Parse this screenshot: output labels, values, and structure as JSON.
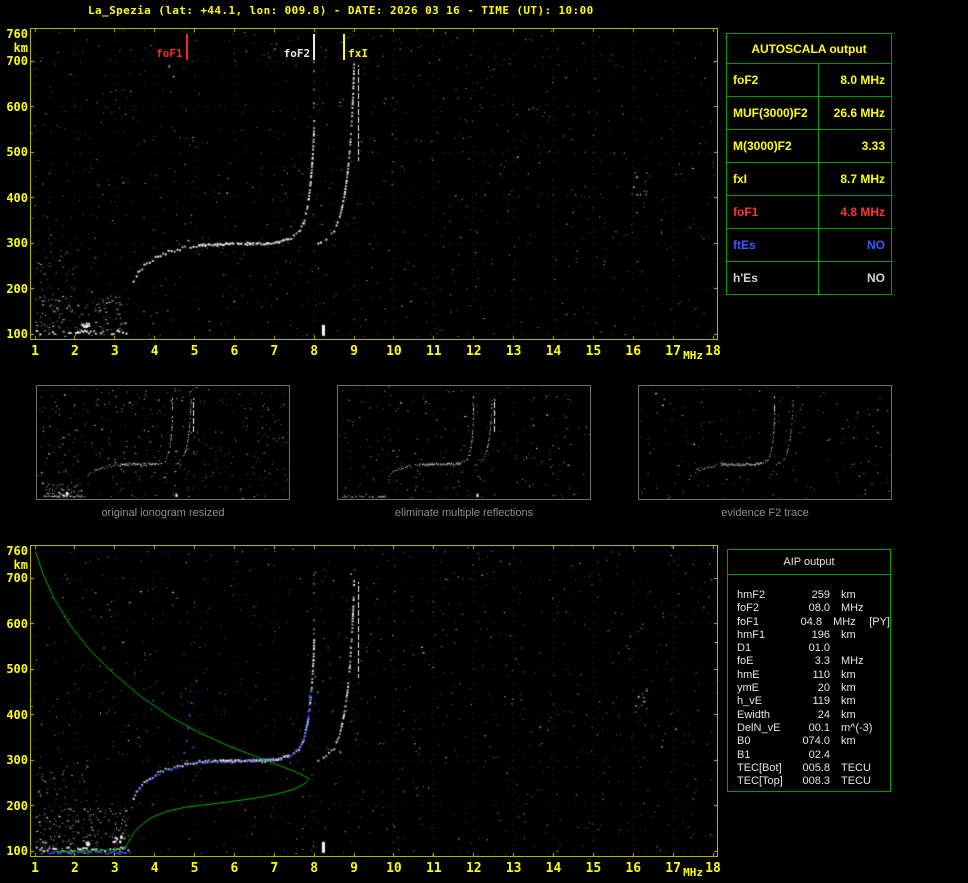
{
  "window": {
    "title": "La_Spezia (lat: +44.1, lon: 009.8) - DATE: 2026 03 16 - TIME (UT): 10:00"
  },
  "axes": {
    "x_ticks": [
      "1",
      "2",
      "3",
      "4",
      "5",
      "6",
      "7",
      "8",
      "9",
      "10",
      "11",
      "12",
      "13",
      "14",
      "15",
      "16",
      "17",
      "18"
    ],
    "x_unit": "MHz",
    "y_ticks": [
      "760",
      "700",
      "600",
      "500",
      "400",
      "300",
      "200",
      "100"
    ],
    "y_unit": "km"
  },
  "top_panel": {
    "markers": [
      {
        "label": "foF1",
        "f": 4.8,
        "color": "#ff2222",
        "side": "left"
      },
      {
        "label": "foF2",
        "f": 8.0,
        "color": "#e8e8e8",
        "side": "left"
      },
      {
        "label": "fxI",
        "f": 8.75,
        "color": "#ffff00",
        "side": "right"
      }
    ]
  },
  "thumbnails": [
    {
      "caption": "original ionogram resized"
    },
    {
      "caption": "eliminate multiple reflections"
    },
    {
      "caption": "evidence F2 trace"
    }
  ],
  "autoscala": {
    "title": "AUTOSCALA output",
    "rows": [
      {
        "param": "foF2",
        "value": "8.0 MHz",
        "color": "#ffff00"
      },
      {
        "param": "MUF(3000)F2",
        "value": "26.6 MHz",
        "color": "#ffff00"
      },
      {
        "param": "M(3000)F2",
        "value": "3.33",
        "color": "#ffff00"
      },
      {
        "param": "fxI",
        "value": "8.7 MHz",
        "color": "#ffff00"
      },
      {
        "param": "foF1",
        "value": "4.8 MHz",
        "color": "#ff3333"
      },
      {
        "param": "ftEs",
        "value": "NO",
        "color": "#3a5bff"
      },
      {
        "param": "h'Es",
        "value": "NO",
        "color": "#d4d4d4"
      }
    ]
  },
  "aip": {
    "title": "AIP output",
    "rows": [
      {
        "param": "hmF2",
        "value": "259",
        "unit": "km",
        "extra": ""
      },
      {
        "param": "foF2",
        "value": "08.0",
        "unit": "MHz",
        "extra": ""
      },
      {
        "param": "foF1",
        "value": "04.8",
        "unit": "MHz",
        "extra": "[PY]"
      },
      {
        "param": "hmF1",
        "value": "196",
        "unit": "km",
        "extra": ""
      },
      {
        "param": "D1",
        "value": "01.0",
        "unit": "",
        "extra": ""
      },
      {
        "param": "foE",
        "value": "3.3",
        "unit": "MHz",
        "extra": ""
      },
      {
        "param": "hmE",
        "value": "110",
        "unit": "km",
        "extra": ""
      },
      {
        "param": "ymE",
        "value": "20",
        "unit": "km",
        "extra": ""
      },
      {
        "param": "h_vE",
        "value": "119",
        "unit": "km",
        "extra": ""
      },
      {
        "param": "Ewidth",
        "value": "24",
        "unit": "km",
        "extra": ""
      },
      {
        "param": "DelN_vE",
        "value": "00.1",
        "unit": "m^(-3)",
        "extra": ""
      },
      {
        "param": "B0",
        "value": "074.0",
        "unit": "km",
        "extra": ""
      },
      {
        "param": "B1",
        "value": "02.4",
        "unit": "",
        "extra": ""
      },
      {
        "param": "TEC[Bot]",
        "value": "005.8",
        "unit": "TECU",
        "extra": ""
      },
      {
        "param": "TEC[Top]",
        "value": "008.3",
        "unit": "TECU",
        "extra": ""
      }
    ]
  },
  "chart_data": {
    "type": "scatter",
    "title": "ionogram virtual height vs frequency",
    "x_range": [
      1,
      18
    ],
    "x_unit": "MHz",
    "y_range": [
      100,
      760
    ],
    "y_unit": "km",
    "e_layer_height": 105,
    "markers": {
      "foF1": 4.8,
      "foF2": 8.0,
      "fxI": 8.7
    },
    "o_trace": [
      [
        3.45,
        218
      ],
      [
        3.6,
        242
      ],
      [
        3.78,
        258
      ],
      [
        4.0,
        270
      ],
      [
        4.25,
        280
      ],
      [
        4.55,
        288
      ],
      [
        4.8,
        294
      ],
      [
        5.1,
        298
      ],
      [
        5.7,
        300
      ],
      [
        6.3,
        300
      ],
      [
        6.9,
        302
      ],
      [
        7.15,
        305
      ],
      [
        7.4,
        313
      ],
      [
        7.6,
        327
      ],
      [
        7.72,
        348
      ],
      [
        7.8,
        378
      ],
      [
        7.87,
        420
      ],
      [
        7.92,
        468
      ],
      [
        7.96,
        525
      ],
      [
        7.98,
        575
      ]
    ],
    "x_trace": [
      [
        8.08,
        300
      ],
      [
        8.28,
        310
      ],
      [
        8.48,
        328
      ],
      [
        8.62,
        358
      ],
      [
        8.72,
        398
      ],
      [
        8.81,
        452
      ],
      [
        8.88,
        518
      ],
      [
        8.93,
        588
      ],
      [
        8.96,
        648
      ],
      [
        8.98,
        700
      ]
    ],
    "blue_restored_trace": [
      [
        3.5,
        228
      ],
      [
        3.72,
        250
      ],
      [
        3.95,
        264
      ],
      [
        4.25,
        277
      ],
      [
        4.55,
        286
      ],
      [
        4.85,
        293
      ],
      [
        5.25,
        297
      ],
      [
        5.9,
        299
      ],
      [
        6.5,
        301
      ],
      [
        7.05,
        304
      ],
      [
        7.35,
        310
      ],
      [
        7.55,
        322
      ],
      [
        7.7,
        344
      ],
      [
        7.8,
        378
      ],
      [
        7.86,
        425
      ],
      [
        7.9,
        470
      ]
    ],
    "blue_cusp_points": [
      [
        4.72,
        318
      ],
      [
        4.78,
        345
      ],
      [
        4.82,
        372
      ],
      [
        4.86,
        400
      ],
      [
        4.9,
        428
      ],
      [
        4.78,
        300
      ],
      [
        4.95,
        330
      ]
    ],
    "profile_topside": [
      [
        1.02,
        758
      ],
      [
        1.2,
        710
      ],
      [
        1.5,
        652
      ],
      [
        1.9,
        595
      ],
      [
        2.4,
        540
      ],
      [
        3.0,
        488
      ],
      [
        3.7,
        437
      ],
      [
        4.4,
        395
      ],
      [
        5.1,
        361
      ],
      [
        5.8,
        333
      ],
      [
        6.5,
        309
      ],
      [
        7.1,
        289
      ],
      [
        7.55,
        273
      ],
      [
        7.8,
        263
      ],
      [
        7.88,
        259
      ]
    ],
    "profile_bottomside": [
      [
        7.88,
        259
      ],
      [
        7.75,
        247
      ],
      [
        7.5,
        236
      ],
      [
        7.1,
        226
      ],
      [
        6.5,
        216
      ],
      [
        5.85,
        208
      ],
      [
        5.2,
        201
      ],
      [
        4.75,
        196
      ],
      [
        4.3,
        187
      ],
      [
        3.95,
        175
      ],
      [
        3.72,
        161
      ],
      [
        3.52,
        145
      ],
      [
        3.4,
        129
      ],
      [
        3.32,
        116
      ],
      [
        3.27,
        108
      ],
      [
        3.0,
        103
      ],
      [
        2.6,
        101
      ],
      [
        2.1,
        100
      ],
      [
        1.5,
        99
      ]
    ]
  }
}
